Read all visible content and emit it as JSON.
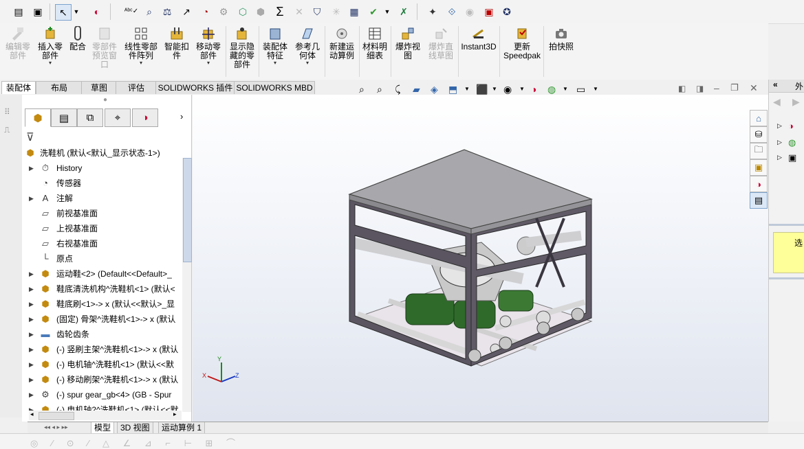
{
  "toolbar_icons": [
    "new-file-icon",
    "open-file-icon",
    "select-arrow-icon",
    "dropdown-icon",
    "appearance-icon",
    "spell-check-icon",
    "find-icon",
    "balance-icon",
    "curve-icon",
    "gauge-icon",
    "gear-icon",
    "cube-icon",
    "shield-icon",
    "sigma-icon",
    "scale-icon",
    "stack-icon",
    "sparkle-icon",
    "clipboard-icon",
    "check-icon",
    "dropdown-icon",
    "excel-icon",
    "palette-icon",
    "pattern-icon",
    "circle-check-icon",
    "calendar-icon",
    "help-icon"
  ],
  "commands": [
    {
      "label": "编辑零\n部件",
      "disabled": true
    },
    {
      "label": "插入零\n部件",
      "disabled": false,
      "dropdown": true
    },
    {
      "label": "配合",
      "disabled": false
    },
    {
      "label": "零部件\n预览窗\n口",
      "disabled": true
    },
    {
      "label": "线性零部\n件阵列",
      "disabled": false,
      "dropdown": true
    },
    {
      "label": "智能扣\n件",
      "disabled": false
    },
    {
      "label": "移动零\n部件",
      "disabled": false,
      "dropdown": true
    },
    {
      "label": "显示隐\n藏的零\n部件",
      "disabled": false
    },
    {
      "label": "装配体\n特征",
      "disabled": false,
      "dropdown": true
    },
    {
      "label": "参考几\n何体",
      "disabled": false,
      "dropdown": true
    },
    {
      "label": "新建运\n动算例",
      "disabled": false
    },
    {
      "label": "材料明\n细表",
      "disabled": false
    },
    {
      "label": "爆炸视\n图",
      "disabled": false
    },
    {
      "label": "爆炸直\n线草图",
      "disabled": true
    },
    {
      "label": "Instant3D",
      "disabled": false
    },
    {
      "label": "更新\nSpeedpak",
      "disabled": false
    },
    {
      "label": "拍快照",
      "disabled": false
    }
  ],
  "tabs": [
    "装配体",
    "布局",
    "草图",
    "评估",
    "SOLIDWORKS 插件",
    "SOLIDWORKS MBD"
  ],
  "active_tab": "装配体",
  "tree": {
    "root": "洗鞋机  (默认<默认_显示状态-1>)",
    "items": [
      {
        "label": "History",
        "icon": "history-icon",
        "arrow": "▶"
      },
      {
        "label": "传感器",
        "icon": "sensor-icon",
        "arrow": ""
      },
      {
        "label": "注解",
        "icon": "annotation-icon",
        "arrow": "▶"
      },
      {
        "label": "前视基准面",
        "icon": "plane-icon",
        "arrow": ""
      },
      {
        "label": "上视基准面",
        "icon": "plane-icon",
        "arrow": ""
      },
      {
        "label": "右视基准面",
        "icon": "plane-icon",
        "arrow": ""
      },
      {
        "label": "原点",
        "icon": "origin-icon",
        "arrow": ""
      },
      {
        "label": "运动鞋<2> (Default<<Default>_",
        "icon": "part-icon",
        "arrow": "▶"
      },
      {
        "label": "鞋底清洗机构^洗鞋机<1> (默认<",
        "icon": "part-icon",
        "arrow": "▶"
      },
      {
        "label": "鞋底刷<1>-> x (默认<<默认>_显",
        "icon": "part-icon",
        "arrow": "▶"
      },
      {
        "label": "(固定) 骨架^洗鞋机<1>-> x (默认",
        "icon": "part-icon",
        "arrow": "▶"
      },
      {
        "label": "齿轮齿条",
        "icon": "folder-icon",
        "arrow": "▶"
      },
      {
        "label": "(-) 竖刷主架^洗鞋机<1>-> x (默认",
        "icon": "part-icon",
        "arrow": "▶"
      },
      {
        "label": "(-) 电机轴^洗鞋机<1> (默认<<默",
        "icon": "part-icon",
        "arrow": "▶"
      },
      {
        "label": "(-) 移动刷架^洗鞋机<1>-> x (默认",
        "icon": "part-icon",
        "arrow": "▶"
      },
      {
        "label": "(-) spur gear_gb<4> (GB - Spur",
        "icon": "gear-part-icon",
        "arrow": "▶"
      },
      {
        "label": "(-) 电机轴2^洗鞋机<1> (默认<<默",
        "icon": "part-icon",
        "arrow": "▶"
      }
    ]
  },
  "bottom_tabs": [
    "模型",
    "3D 视图",
    "运动算例 1"
  ],
  "active_bottom_tab": "模型",
  "triad": {
    "x": "X",
    "y": "Y",
    "z": "Z"
  },
  "right_panel": {
    "header": "外",
    "note": "选"
  },
  "colors": {
    "frame": "#5a5560",
    "top_plate": "#a8a8ac",
    "accent_green": "#2f6a2a",
    "selected_tab": "#ffffff",
    "note_yellow": "#ffff99"
  }
}
